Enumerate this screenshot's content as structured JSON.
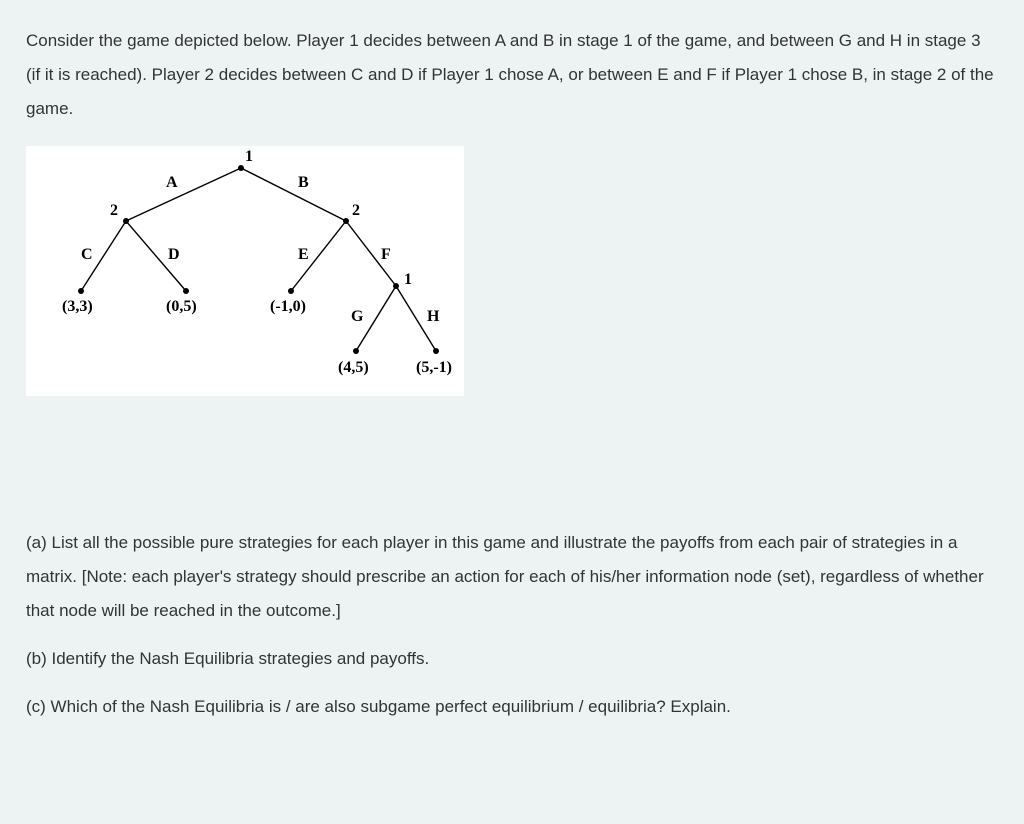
{
  "intro": "Consider the game depicted below. Player 1 decides between A and B in stage 1 of the game, and between G and H in stage 3 (if it is reached). Player 2 decides between C and D if Player 1 chose A, or between E and F if Player 1 chose B, in stage 2 of the game.",
  "tree": {
    "nodes": {
      "root": "1",
      "leftP2": "2",
      "rightP2": "2",
      "p1sub": "1"
    },
    "branches": {
      "A": "A",
      "B": "B",
      "C": "C",
      "D": "D",
      "E": "E",
      "F": "F",
      "G": "G",
      "H": "H"
    },
    "payoffs": {
      "C": "(3,3)",
      "D": "(0,5)",
      "E": "(-1,0)",
      "G": "(4,5)",
      "H": "(5,-1)"
    }
  },
  "questions": {
    "a": "(a) List all the possible pure strategies for each player in this game and illustrate the payoffs from each pair of strategies in a matrix. [Note: each player's strategy should prescribe an action for each of his/her information node (set), regardless of whether that node will be reached in the outcome.]",
    "b": "(b) Identify the Nash Equilibria strategies and payoffs.",
    "c": "(c) Which of the Nash Equilibria is / are also subgame perfect equilibrium / equilibria? Explain."
  },
  "chart_data": {
    "type": "game-tree",
    "players": {
      "1": "Player 1",
      "2": "Player 2"
    },
    "root": {
      "player": 1,
      "children": {
        "A": {
          "player": 2,
          "children": {
            "C": {
              "payoff": [
                3,
                3
              ]
            },
            "D": {
              "payoff": [
                0,
                5
              ]
            }
          }
        },
        "B": {
          "player": 2,
          "children": {
            "E": {
              "payoff": [
                -1,
                0
              ]
            },
            "F": {
              "player": 1,
              "children": {
                "G": {
                  "payoff": [
                    4,
                    5
                  ]
                },
                "H": {
                  "payoff": [
                    5,
                    -1
                  ]
                }
              }
            }
          }
        }
      }
    }
  }
}
